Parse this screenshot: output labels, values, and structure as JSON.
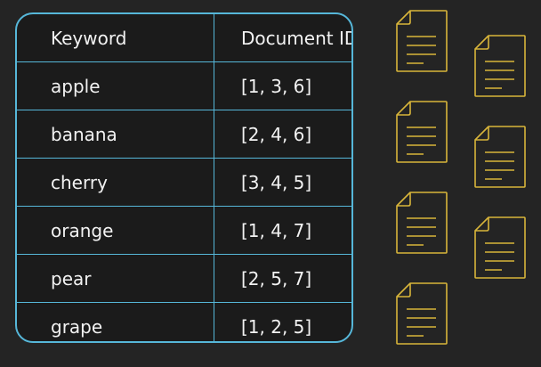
{
  "table": {
    "headers": [
      "Keyword",
      "Document ID"
    ],
    "rows": [
      {
        "keyword": "apple",
        "ids": "[1, 3, 6]"
      },
      {
        "keyword": "banana",
        "ids": "[2, 4, 6]"
      },
      {
        "keyword": "cherry",
        "ids": "[3, 4, 5]"
      },
      {
        "keyword": "orange",
        "ids": "[1, 4, 7]"
      },
      {
        "keyword": "pear",
        "ids": "[2, 5, 7]"
      },
      {
        "keyword": "grape",
        "ids": "[1, 2, 5]"
      }
    ]
  },
  "documents": {
    "count": 7,
    "icon": "document-icon"
  },
  "colors": {
    "background": "#242424",
    "table_border": "#56b7d9",
    "text": "#f2f2f2",
    "document_outline": "#d8b53a"
  }
}
